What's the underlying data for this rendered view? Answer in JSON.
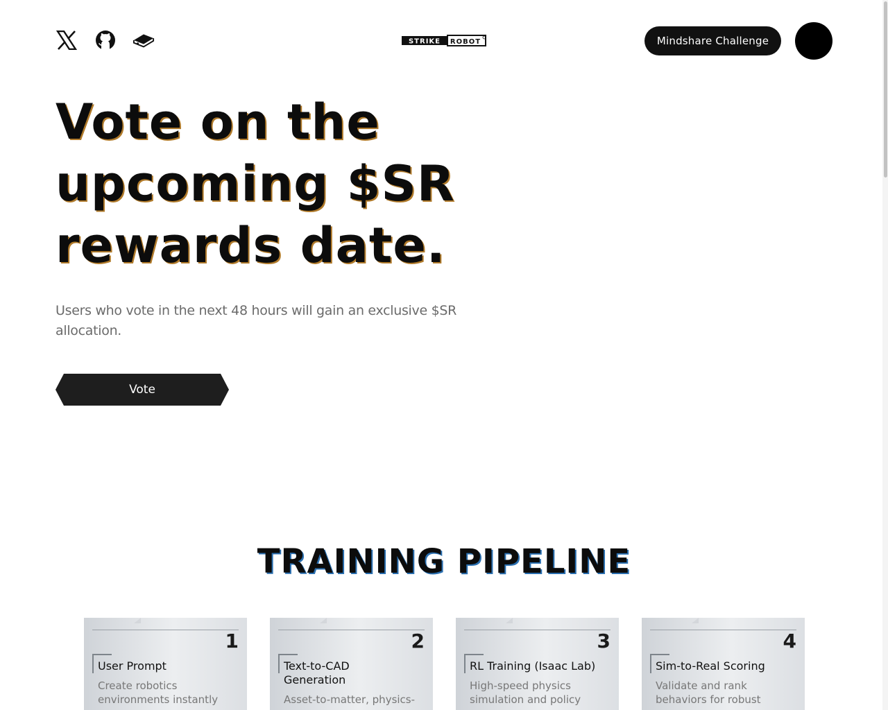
{
  "header": {
    "social": [
      {
        "icon": "x-logo-icon"
      },
      {
        "icon": "github-icon"
      },
      {
        "icon": "book-icon"
      }
    ],
    "logo_text": "STRIKE ROBOT",
    "mindshare_label": "Mindshare Challenge"
  },
  "hero": {
    "title_line1": "Vote on the",
    "title_line2": "upcoming $SR",
    "title_line3": "rewards date.",
    "subtitle": "Users who vote in the next 48 hours will gain an exclusive $SR allocation.",
    "vote_label": "Vote"
  },
  "pipeline": {
    "title": "TRAINING PIPELINE",
    "cards": [
      {
        "number": "1",
        "title": "User Prompt",
        "desc": "Create robotics environments instantly"
      },
      {
        "number": "2",
        "title": "Text-to-CAD Generation",
        "desc": "Asset-to-matter, physics-"
      },
      {
        "number": "3",
        "title": "RL Training (Isaac Lab)",
        "desc": "High-speed physics simulation and policy"
      },
      {
        "number": "4",
        "title": "Sim-to-Real Scoring",
        "desc": "Validate and rank behaviors for robust"
      }
    ]
  },
  "colors": {
    "button_bg": "#1e1e1e",
    "page_bg": "#ffffff",
    "subtitle_text": "#6b6b6b"
  }
}
